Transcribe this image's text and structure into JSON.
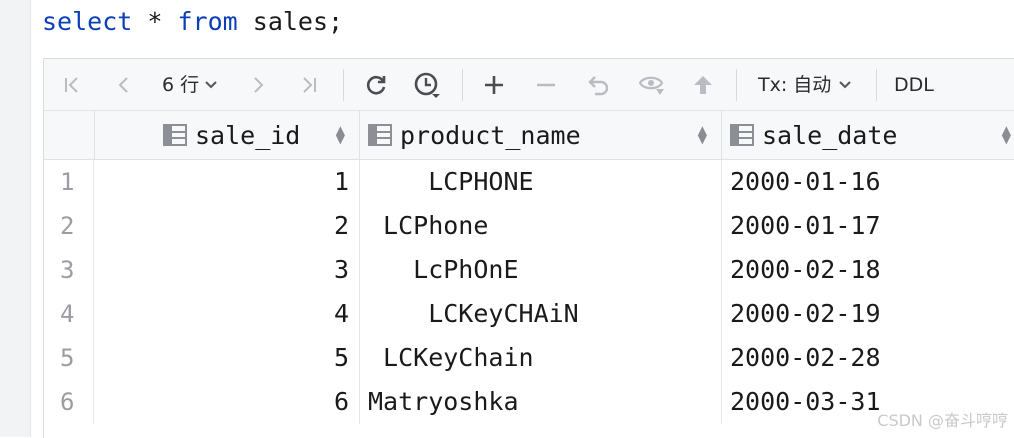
{
  "editor": {
    "sql_kw_select": "select",
    "sql_star": "*",
    "sql_kw_from": "from",
    "sql_rest": "sales;"
  },
  "toolbar": {
    "row_count": "6 行",
    "tx_mode": "Tx: 自动",
    "ddl": "DDL",
    "icons": [
      "first-page-icon",
      "prev-page-icon",
      "next-page-icon",
      "last-page-icon",
      "refresh-icon",
      "history-icon",
      "add-row-icon",
      "delete-row-icon",
      "revert-icon",
      "preview-icon",
      "submit-icon"
    ]
  },
  "columns": [
    {
      "name": "sale_id"
    },
    {
      "name": "product_name"
    },
    {
      "name": "sale_date"
    }
  ],
  "rows": [
    {
      "num": "1",
      "sale_id": "1",
      "product_name": "    LCPHONE",
      "sale_date": "2000-01-16"
    },
    {
      "num": "2",
      "sale_id": "2",
      "product_name": " LCPhone",
      "sale_date": "2000-01-17"
    },
    {
      "num": "3",
      "sale_id": "3",
      "product_name": "   LcPhOnE",
      "sale_date": "2000-02-18"
    },
    {
      "num": "4",
      "sale_id": "4",
      "product_name": "    LCKeyCHAiN",
      "sale_date": "2000-02-19"
    },
    {
      "num": "5",
      "sale_id": "5",
      "product_name": " LCKeyChain",
      "sale_date": "2000-02-28"
    },
    {
      "num": "6",
      "sale_id": "6",
      "product_name": "Matryoshka",
      "sale_date": "2000-03-31"
    }
  ],
  "watermark": "CSDN @奋斗哼哼"
}
